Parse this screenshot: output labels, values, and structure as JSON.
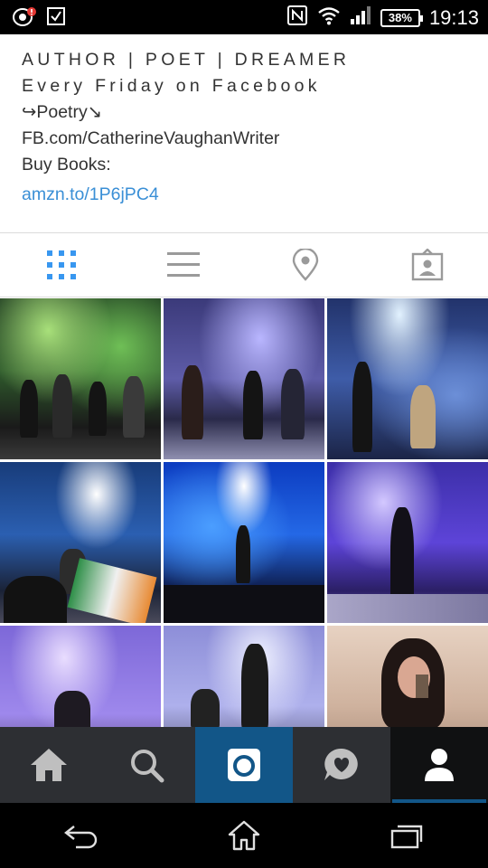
{
  "status_bar": {
    "time": "19:13",
    "battery": "38%",
    "icons": [
      "notification-alert-icon",
      "checkbox-icon",
      "nfc-icon",
      "wifi-icon",
      "signal-icon",
      "battery-icon"
    ]
  },
  "bio": {
    "line1": "AUTHOR | POET | DREAMER",
    "line2": "Every Friday on Facebook",
    "line3": "↪Poetry↘",
    "line4": "FB.com/CatherineVaughanWriter",
    "line5": "Buy Books:",
    "link": "amzn.to/1P6jPC4"
  },
  "tabs": [
    {
      "name": "grid-view",
      "icon": "grid-icon",
      "active": true
    },
    {
      "name": "list-view",
      "icon": "list-icon",
      "active": false
    },
    {
      "name": "places",
      "icon": "location-pin-icon",
      "active": false
    },
    {
      "name": "tagged",
      "icon": "tagged-photos-icon",
      "active": false
    }
  ],
  "photos": [
    {
      "scene": "band on stage, green lights"
    },
    {
      "scene": "violinists on stage, purple lights"
    },
    {
      "scene": "singer with accordion, blue lights"
    },
    {
      "scene": "crowd with flag, blue stage"
    },
    {
      "scene": "singer on stage, bright blue"
    },
    {
      "scene": "singer with microphone, violet"
    },
    {
      "scene": "guitarist, purple"
    },
    {
      "scene": "blonde singer, drums"
    },
    {
      "scene": "selfie in room"
    }
  ],
  "bottom_nav": [
    {
      "name": "home",
      "icon": "home-icon"
    },
    {
      "name": "search",
      "icon": "search-icon"
    },
    {
      "name": "camera",
      "icon": "camera-icon"
    },
    {
      "name": "activity",
      "icon": "heart-bubble-icon"
    },
    {
      "name": "profile",
      "icon": "person-icon"
    }
  ],
  "android_nav": [
    "back-icon",
    "home-outline-icon",
    "recents-icon"
  ],
  "colors": {
    "accent_blue": "#3897f0",
    "link_blue": "#3a8fd6",
    "camera_tab": "#125688",
    "nav_bar": "#2d2f33"
  }
}
